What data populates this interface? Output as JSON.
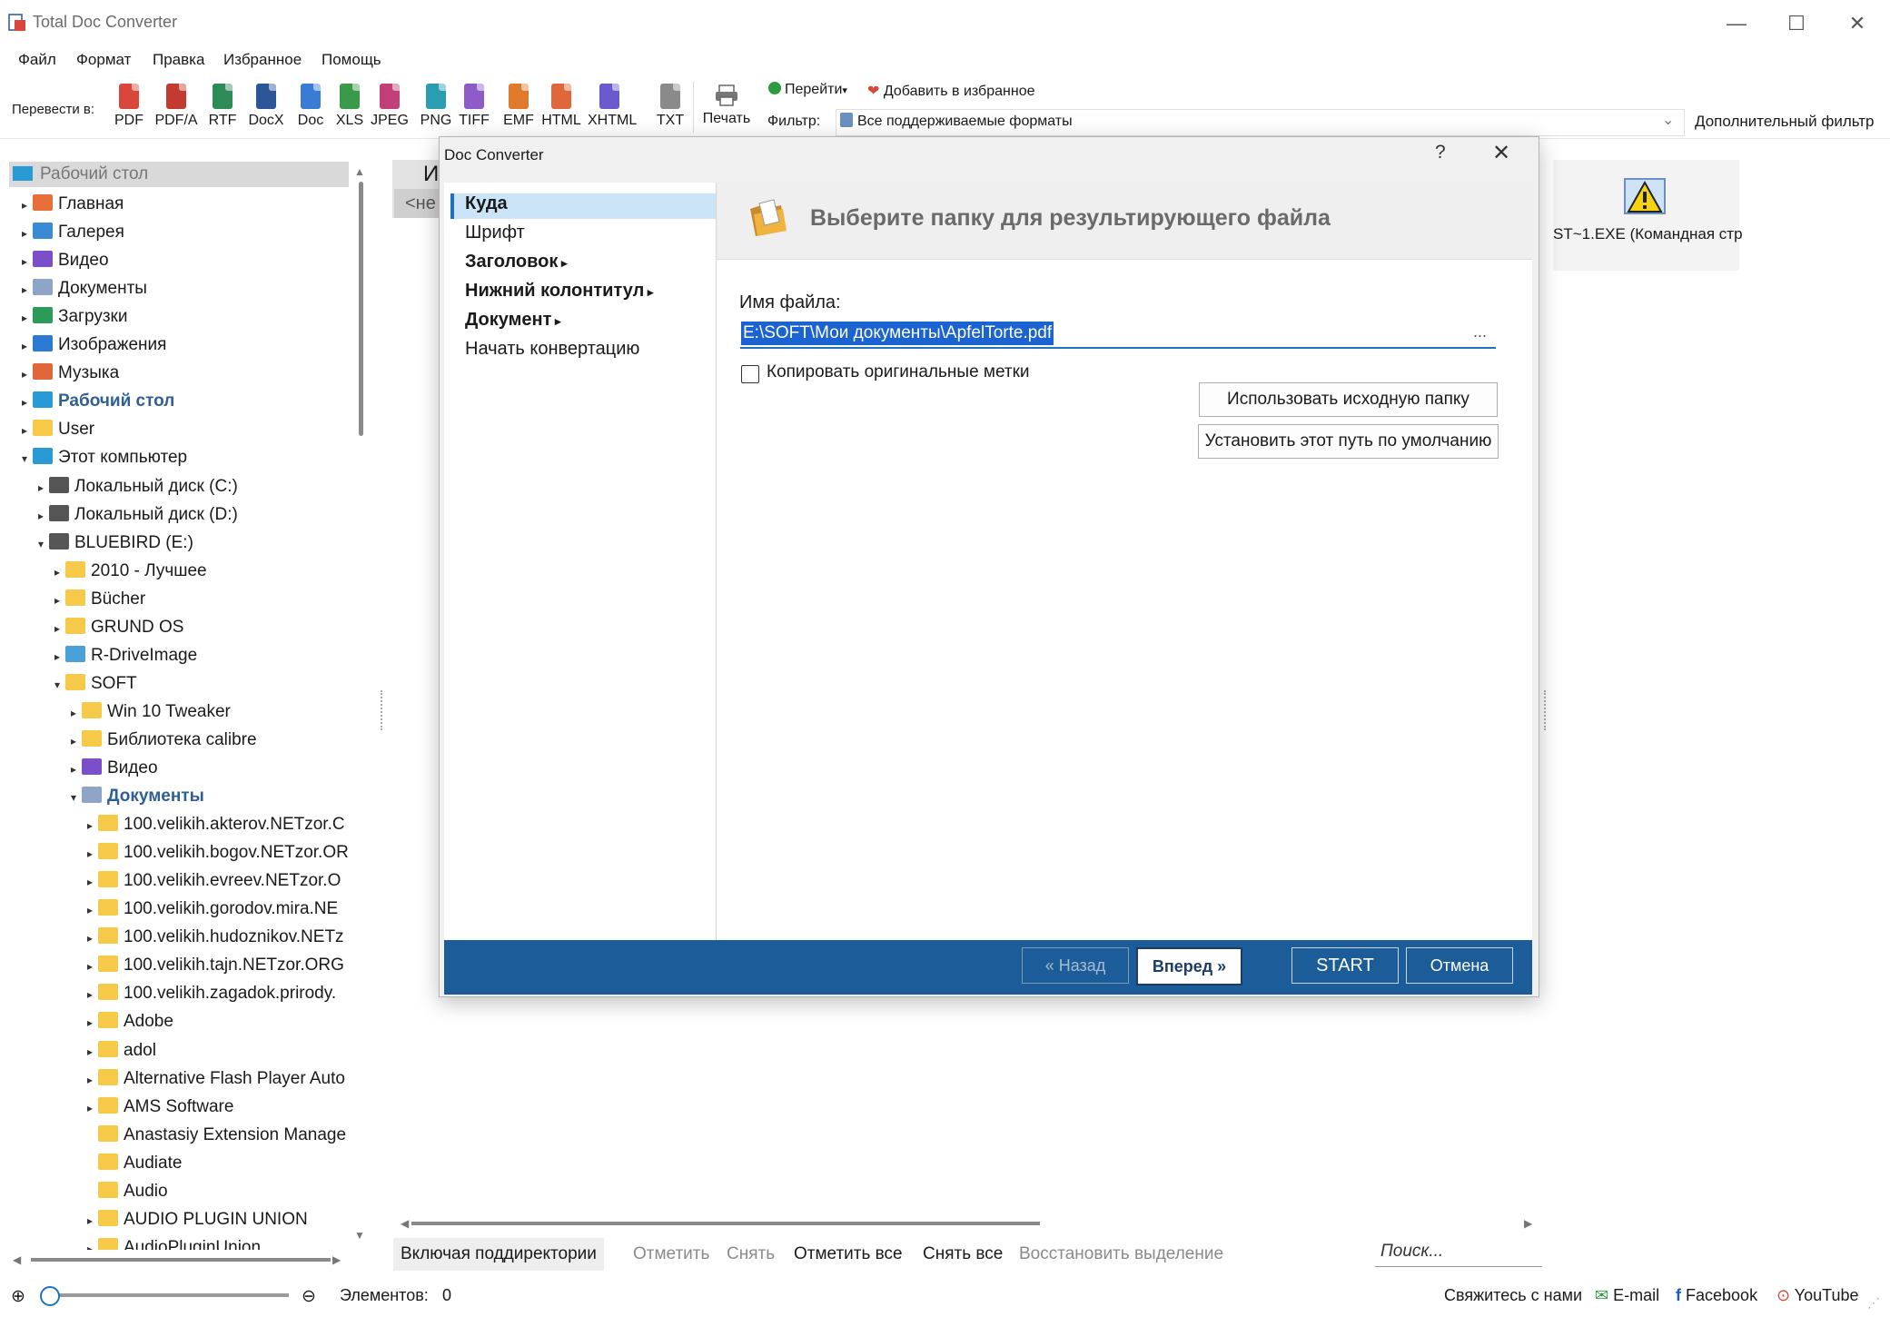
{
  "window": {
    "title": "Total Doc Converter",
    "controls": {
      "minimize": "—",
      "maximize": "☐",
      "close": "✕"
    }
  },
  "menu": [
    "Файл",
    "Формат",
    "Правка",
    "Избранное",
    "Помощь"
  ],
  "toolbar": {
    "convert_label": "Перевести в:",
    "formats": [
      {
        "label": "PDF",
        "color": "#d9473b"
      },
      {
        "label": "PDF/A",
        "color": "#c23a30"
      },
      {
        "label": "RTF",
        "color": "#2e8b57"
      },
      {
        "label": "DocX",
        "color": "#2b5797"
      },
      {
        "label": "Doc",
        "color": "#3a7bd5"
      },
      {
        "label": "XLS",
        "color": "#3a9a4a"
      },
      {
        "label": "JPEG",
        "color": "#c2407a"
      },
      {
        "label": "PNG",
        "color": "#2a9db0"
      },
      {
        "label": "TIFF",
        "color": "#8e5bc9"
      },
      {
        "label": "EMF",
        "color": "#e07b2e"
      },
      {
        "label": "HTML",
        "color": "#e0673a"
      },
      {
        "label": "XHTML",
        "color": "#6a5acd"
      },
      {
        "label": "TXT",
        "color": "#8a8a8a"
      }
    ],
    "print_label": "Печать",
    "goto_label": "Перейти",
    "favorites_label": "Добавить в избранное",
    "filter_label": "Фильтр:",
    "filter_value": "Все поддерживаемые форматы",
    "extra_filter_label": "Дополнительный фильтр"
  },
  "tree": {
    "header": "Рабочий стол",
    "nodes": [
      {
        "label": "Главная",
        "level": 0,
        "arrow": "▸",
        "icon": "home-icon"
      },
      {
        "label": "Галерея",
        "level": 0,
        "arrow": "▸",
        "icon": "gallery-icon"
      },
      {
        "label": "Видео",
        "level": 0,
        "arrow": "▸",
        "icon": "video-icon"
      },
      {
        "label": "Документы",
        "level": 0,
        "arrow": "▸",
        "icon": "documents-icon"
      },
      {
        "label": "Загрузки",
        "level": 0,
        "arrow": "▸",
        "icon": "download-icon"
      },
      {
        "label": "Изображения",
        "level": 0,
        "arrow": "▸",
        "icon": "pictures-icon"
      },
      {
        "label": "Музыка",
        "level": 0,
        "arrow": "▸",
        "icon": "music-icon"
      },
      {
        "label": "Рабочий стол",
        "level": 0,
        "arrow": "▸",
        "icon": "desktop-icon",
        "bold": true
      },
      {
        "label": "User",
        "level": 0,
        "arrow": "▸",
        "icon": "folder-icon"
      },
      {
        "label": "Этот компьютер",
        "level": 0,
        "arrow": "▾",
        "icon": "computer-icon"
      },
      {
        "label": "Локальный диск (C:)",
        "level": 1,
        "arrow": "▸",
        "icon": "drive-icon"
      },
      {
        "label": "Локальный диск (D:)",
        "level": 1,
        "arrow": "▸",
        "icon": "drive-icon"
      },
      {
        "label": "BLUEBIRD (E:)",
        "level": 1,
        "arrow": "▾",
        "icon": "drive-icon"
      },
      {
        "label": "2010 - Лучшее",
        "level": 2,
        "arrow": "▸",
        "icon": "folder-icon"
      },
      {
        "label": "Bücher",
        "level": 2,
        "arrow": "▸",
        "icon": "folder-icon"
      },
      {
        "label": "GRUND OS",
        "level": 2,
        "arrow": "▸",
        "icon": "folder-icon"
      },
      {
        "label": "R-DriveImage",
        "level": 2,
        "arrow": "▸",
        "icon": "app-folder-icon"
      },
      {
        "label": "SOFT",
        "level": 2,
        "arrow": "▾",
        "icon": "folder-icon"
      },
      {
        "label": "Win 10 Tweaker",
        "level": 3,
        "arrow": "▸",
        "icon": "folder-icon"
      },
      {
        "label": "Библиотека calibre",
        "level": 3,
        "arrow": "▸",
        "icon": "folder-icon"
      },
      {
        "label": "Видео",
        "level": 3,
        "arrow": "▸",
        "icon": "video-icon"
      },
      {
        "label": "Документы",
        "level": 3,
        "arrow": "▾",
        "icon": "documents-icon",
        "bold": true
      },
      {
        "label": "100.velikih.akterov.NETzor.C",
        "level": 4,
        "arrow": "▸",
        "icon": "folder-icon"
      },
      {
        "label": "100.velikih.bogov.NETzor.OR",
        "level": 4,
        "arrow": "▸",
        "icon": "folder-icon"
      },
      {
        "label": "100.velikih.evreev.NETzor.O",
        "level": 4,
        "arrow": "▸",
        "icon": "folder-icon"
      },
      {
        "label": "100.velikih.gorodov.mira.NE",
        "level": 4,
        "arrow": "▸",
        "icon": "folder-icon"
      },
      {
        "label": "100.velikih.hudoznikov.NETz",
        "level": 4,
        "arrow": "▸",
        "icon": "folder-icon"
      },
      {
        "label": "100.velikih.tajn.NETzor.ORG",
        "level": 4,
        "arrow": "▸",
        "icon": "folder-icon"
      },
      {
        "label": "100.velikih.zagadok.prirody.",
        "level": 4,
        "arrow": "▸",
        "icon": "folder-icon"
      },
      {
        "label": "Adobe",
        "level": 4,
        "arrow": "▸",
        "icon": "folder-icon"
      },
      {
        "label": "adol",
        "level": 4,
        "arrow": "▸",
        "icon": "folder-icon"
      },
      {
        "label": "Alternative Flash Player Auto",
        "level": 4,
        "arrow": "▸",
        "icon": "folder-icon"
      },
      {
        "label": "AMS Software",
        "level": 4,
        "arrow": "▸",
        "icon": "folder-icon"
      },
      {
        "label": "Anastasiy Extension Manage",
        "level": 4,
        "arrow": "",
        "icon": "folder-icon"
      },
      {
        "label": "Audiate",
        "level": 4,
        "arrow": "",
        "icon": "folder-icon"
      },
      {
        "label": "Audio",
        "level": 4,
        "arrow": "",
        "icon": "folder-icon"
      },
      {
        "label": "AUDIO PLUGIN UNION",
        "level": 4,
        "arrow": "▸",
        "icon": "folder-icon"
      },
      {
        "label": "AudioPluginUnion",
        "level": 4,
        "arrow": "▸",
        "icon": "folder-icon"
      }
    ]
  },
  "file_panel": {
    "header_partial": "И",
    "nav_partial": "<не",
    "item_label": "ST~1.EXE (Командная стр"
  },
  "action_bar": {
    "include_subdirs": "Включая поддиректории",
    "mark": "Отметить",
    "unmark": "Снять",
    "mark_all": "Отметить все",
    "unmark_all": "Снять все",
    "restore_selection": "Восстановить выделение",
    "search_placeholder": "Поиск..."
  },
  "status": {
    "items_label": "Элементов:",
    "items_count": "0",
    "contact": "Свяжитесь с нами",
    "email": "E-mail",
    "facebook": "Facebook",
    "youtube": "YouTube",
    "zoom_level": 0.0
  },
  "dialog": {
    "title": "Doc Converter",
    "help": "?",
    "close": "✕",
    "nav": [
      {
        "label": "Куда",
        "selected": true,
        "bold": true,
        "submenu": false
      },
      {
        "label": "Шрифт",
        "selected": false,
        "bold": false,
        "submenu": false
      },
      {
        "label": "Заголовок",
        "selected": false,
        "bold": true,
        "submenu": true
      },
      {
        "label": "Нижний колонтитул",
        "selected": false,
        "bold": true,
        "submenu": true
      },
      {
        "label": "Документ",
        "selected": false,
        "bold": true,
        "submenu": true
      },
      {
        "label": "Начать конвертацию",
        "selected": false,
        "bold": false,
        "submenu": false
      }
    ],
    "banner": "Выберите папку для результирующего файла",
    "filename_label": "Имя файла:",
    "filename_value": "E:\\SOFT\\Мои документы\\ApfelTorte.pdf",
    "browse": "...",
    "copy_tags_label": "Копировать оригинальные метки",
    "copy_tags_checked": false,
    "use_source_folder": "Использовать исходную папку",
    "set_default_path": "Установить этот путь по умолчанию",
    "back": "« Назад",
    "next": "Вперед »",
    "start": "START",
    "cancel": "Отмена"
  }
}
